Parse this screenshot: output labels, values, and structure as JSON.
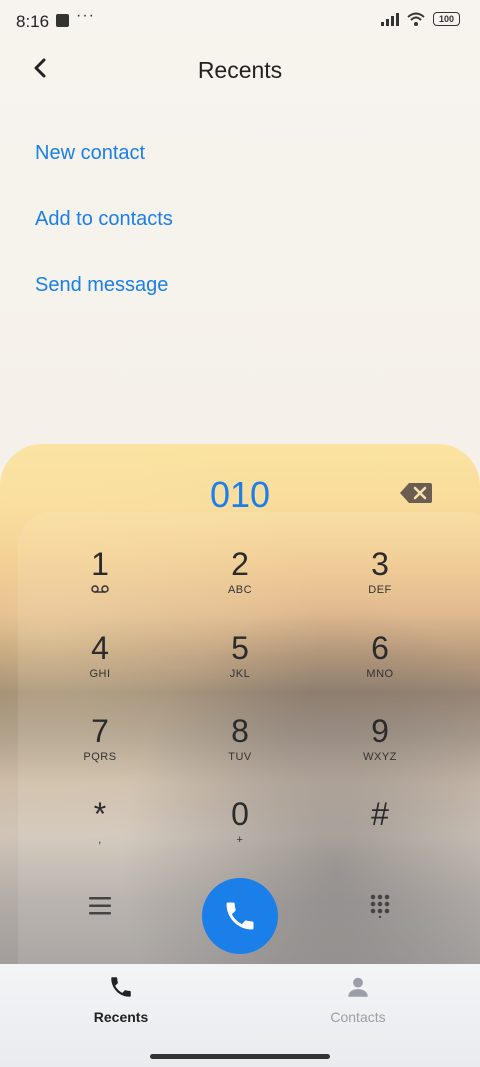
{
  "status": {
    "time": "8:16",
    "more": "···",
    "battery": "100"
  },
  "header": {
    "title": "Recents"
  },
  "actions": [
    "New contact",
    "Add to contacts",
    "Send message"
  ],
  "dialer": {
    "number": "010",
    "keys": [
      {
        "digit": "1",
        "letters": ""
      },
      {
        "digit": "2",
        "letters": "ABC"
      },
      {
        "digit": "3",
        "letters": "DEF"
      },
      {
        "digit": "4",
        "letters": "GHI"
      },
      {
        "digit": "5",
        "letters": "JKL"
      },
      {
        "digit": "6",
        "letters": "MNO"
      },
      {
        "digit": "7",
        "letters": "PQRS"
      },
      {
        "digit": "8",
        "letters": "TUV"
      },
      {
        "digit": "9",
        "letters": "WXYZ"
      },
      {
        "digit": "*",
        "letters": ","
      },
      {
        "digit": "0",
        "letters": "+"
      },
      {
        "digit": "#",
        "letters": ""
      }
    ]
  },
  "nav": {
    "recents": "Recents",
    "contacts": "Contacts"
  },
  "colors": {
    "accent": "#1a7fe8",
    "call_button": "#1a7fe8"
  },
  "icons": [
    "back-icon",
    "backspace-icon",
    "voicemail-icon",
    "menu-icon",
    "phone-icon",
    "keypad-icon",
    "person-icon"
  ]
}
